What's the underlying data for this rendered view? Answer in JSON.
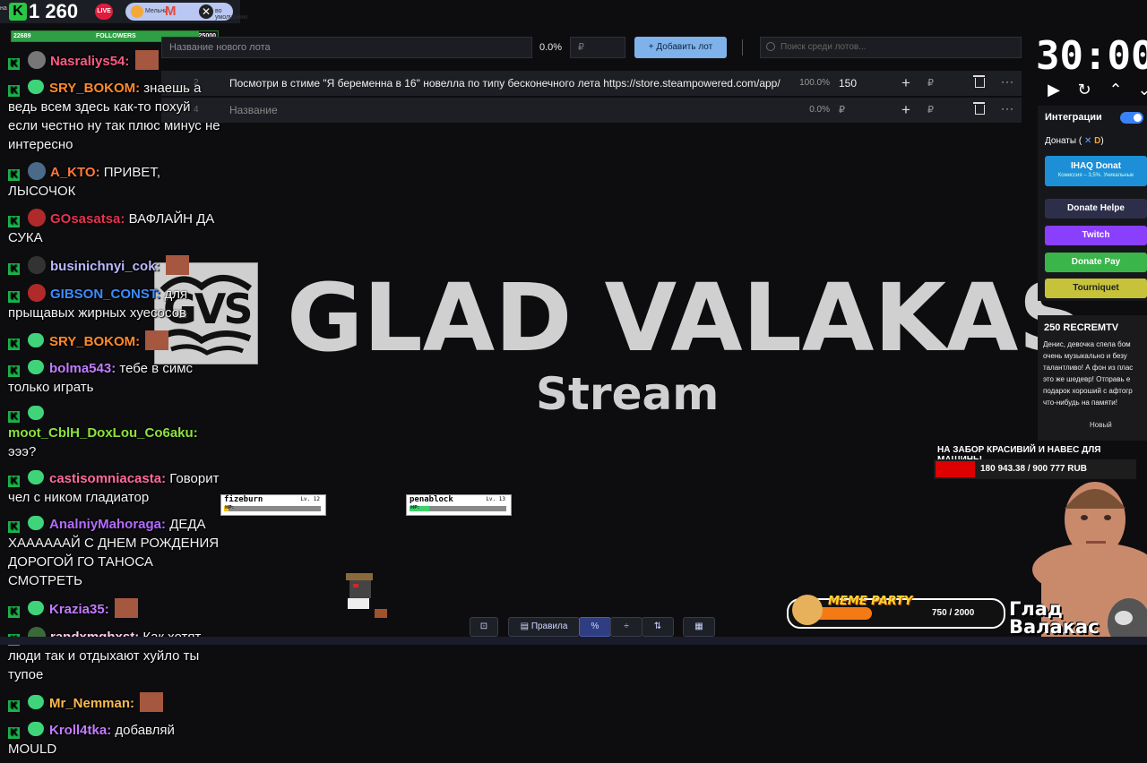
{
  "stats": {
    "viewers": "1 260",
    "live_label": "LIVE",
    "tiny_left": "на",
    "tiny_right": "по умол",
    "pill_left": "Мельни",
    "pill_right": "во умолчанию",
    "followers": {
      "current": "22689",
      "label": "FOLLOWERS",
      "goal": "25000",
      "progress": 0.91
    }
  },
  "auction": {
    "lot_placeholder": "Название нового лота",
    "percent": "0.0%",
    "currency": "₽",
    "add_button": "Добавить лот",
    "search_placeholder": "Поиск среди лотов...",
    "lots": [
      {
        "num": "2",
        "name": "Посмотри в стиме \"Я беременна в 16\" новелла по типу бесконечного лета https://store.steampowered.com/app/",
        "percent": "100.0%",
        "amount": "150",
        "currency": "₽"
      },
      {
        "num": "4",
        "name": "Название",
        "percent": "0.0%",
        "amount": "₽",
        "currency": "₽"
      }
    ]
  },
  "logo": {
    "gvs": "GVS",
    "title": "GLAD VALAKAS",
    "subtitle": "Stream"
  },
  "chat": [
    {
      "user": "Nasraliys54",
      "color": "#ff5a84",
      "text": "",
      "badge": "emote-face"
    },
    {
      "user": "SRY_BOKOM",
      "color": "#ff8a2a",
      "text": "знаешь а ведь всем здесь как-то похуй если честно ну так плюс минус не интересно",
      "badge": "green"
    },
    {
      "user": "A_KTO",
      "color": "#ff7a3c",
      "text": "ПРИВЕТ, ЛЫСОЧОК",
      "badge": "avatar-blue"
    },
    {
      "user": "GOsasatsa",
      "color": "#e8324f",
      "text": "ВАФЛАЙН ДА СУКА",
      "badge": "avatar-red"
    },
    {
      "user": "businichnyi_cok",
      "color": "#b9b9ff",
      "text": "",
      "badge": "avatar-dark"
    },
    {
      "user": "GIBSON_CONST",
      "color": "#3b8cff",
      "text": "для прыщавых жирных хуесосов",
      "badge": "avatar-red"
    },
    {
      "user": "SRY_BOKOM",
      "color": "#ff8a2a",
      "text": "",
      "badge": "green"
    },
    {
      "user": "bolma543",
      "color": "#c47bff",
      "text": "тебе в симс только играть",
      "badge": "green"
    },
    {
      "user": "moot_CblH_DoxLou_Co6aku",
      "color": "#8ce23c",
      "text": "эээ?",
      "badge": "green"
    },
    {
      "user": "castisomniacasta",
      "color": "#ff6b9a",
      "text": "Говорит чел с ником гладиатор",
      "badge": "green"
    },
    {
      "user": "AnalniyMahoraga",
      "color": "#b46bff",
      "text": "ДЕДА ХААААААЙ С ДНЕМ РОЖДЕНИЯ ДОРОГОЙ ГО ТАНОСА СМОТРЕТЬ",
      "badge": "green"
    },
    {
      "user": "Krazia35",
      "color": "#c47bff",
      "text": "",
      "badge": "green"
    },
    {
      "user": "randxmghxst",
      "color": "#ffd0e8",
      "text": "Как хотят люди так и отдыхают хуйло ты тупое",
      "badge": "avatar-green"
    },
    {
      "user": "Mr_Nemman",
      "color": "#ffb84d",
      "text": "",
      "badge": "green"
    },
    {
      "user": "Kroll4tka",
      "color": "#c47bff",
      "text": "добавляй MOULD",
      "badge": "green"
    }
  ],
  "timer": {
    "value": "30:00:",
    "controls": [
      "play-icon",
      "reset-icon",
      "up-icon",
      "down-icon"
    ]
  },
  "integrations": {
    "title": "Интеграции",
    "donations_label": "Донаты (",
    "services": [
      {
        "name": "IHAQ Donat",
        "sub": "Комиссия – 3,5%. Уникальные",
        "color": "#1c8fd6"
      },
      {
        "name": "Donate Helpe",
        "sub": "",
        "color": "#2d2f4a"
      },
      {
        "name": "Twitch",
        "sub": "",
        "color": "#8a3ffc"
      },
      {
        "name": "Donate Pay",
        "sub": "",
        "color": "#39b54a"
      },
      {
        "name": "Tourniquet",
        "sub": "",
        "color": "#c6c23a"
      }
    ]
  },
  "alert": {
    "header": "250 RECREMTV",
    "body": "Денис, девочка спела бом очень музыкально и безу талантливо! А фон из плас это же шедевр! Отправь е подарок хороший с афтогр что-нибудь на памяти!",
    "new_label": "Новый"
  },
  "goal": {
    "title": "НА ЗАБОР КРАСИВИЙ И НАВЕС ДЛЯ МАШИНЫ",
    "progress_text": "180 943.38 / 900 777 RUB",
    "progress": 0.2
  },
  "meme_party": {
    "label": "MEME PARTY",
    "count": "750 / 2000",
    "progress": 0.375
  },
  "streamer_name": {
    "line1": "Глад",
    "line2": "Валакас"
  },
  "players": [
    {
      "name": "fizeburn",
      "level": "Lv. 12",
      "hp_label": "HP:",
      "hp": 0.05
    },
    {
      "name": "penablock",
      "level": "Lv. 13",
      "hp_label": "HP:",
      "hp": 0.2
    }
  ],
  "toolbar": {
    "rules": "Правила",
    "percent_icon": "%"
  }
}
